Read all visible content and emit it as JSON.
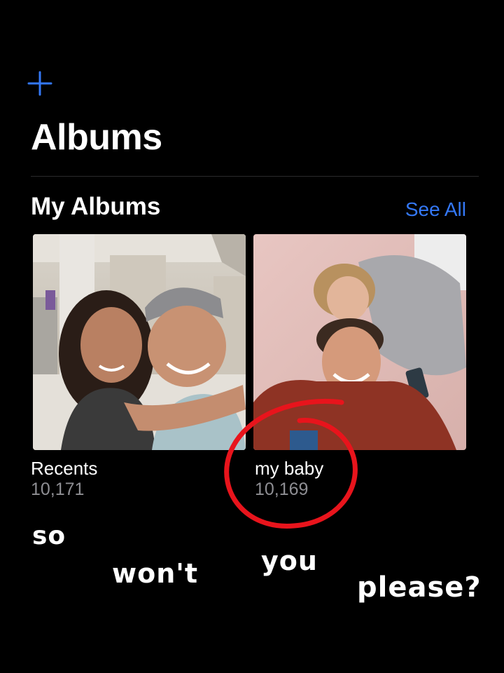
{
  "header": {
    "title": "Albums",
    "add_icon": "plus-icon",
    "accent_color": "#3478f6"
  },
  "my_albums": {
    "section_title": "My Albums",
    "see_all_label": "See All",
    "albums": [
      {
        "name": "Recents",
        "count": "10,171",
        "thumbnail": "photo of a couple hugging in an airport"
      },
      {
        "name": "my baby",
        "count": "10,169",
        "thumbnail": "photo of a couple lying on a pink blanket"
      }
    ]
  },
  "overlay": {
    "circle_color": "#e8141c",
    "words": [
      "so",
      "won't",
      "you",
      "please?"
    ]
  }
}
